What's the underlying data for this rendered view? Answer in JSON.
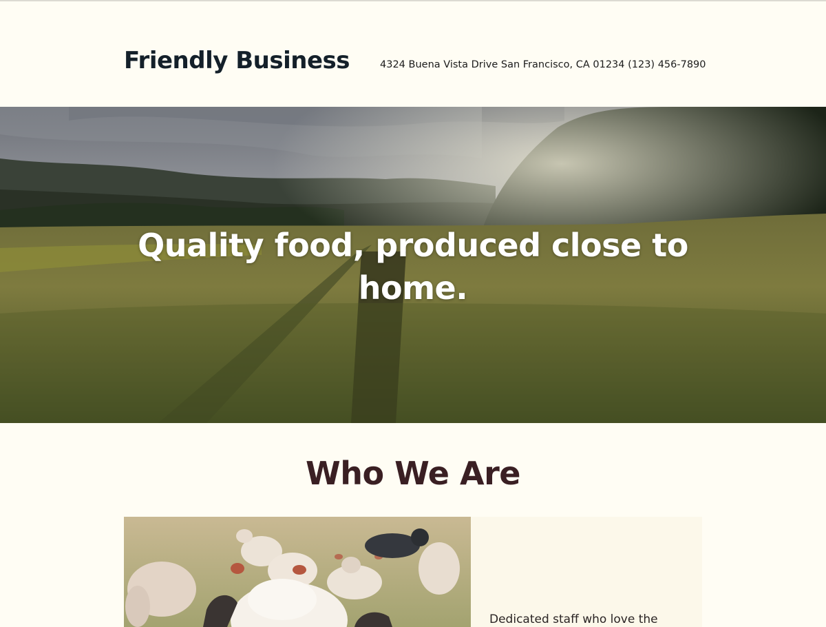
{
  "header": {
    "site_title": "Friendly Business",
    "contact": "4324 Buena Vista Drive San Francisco, CA 01234 (123) 456-7890"
  },
  "hero": {
    "heading_line1": "Quality food, produced close to",
    "heading_line2": "home.",
    "image": "wheat-field-landscape"
  },
  "about": {
    "title": "Who We Are",
    "image": "sheep-in-field",
    "text": "Dedicated staff who love the"
  },
  "colors": {
    "background": "#fffdf4",
    "title": "#14202a",
    "section_title": "#3a1f23",
    "card_background": "#fcf8ea"
  }
}
